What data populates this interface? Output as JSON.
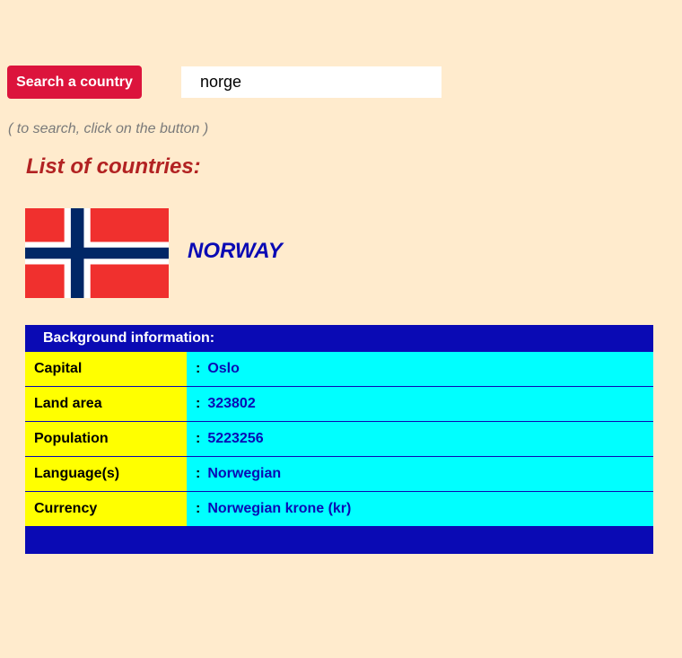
{
  "search": {
    "button_label": "Search a country",
    "input_value": "norge",
    "hint": "( to search, click on the button )"
  },
  "list_title": "List of countries:",
  "country": {
    "name": "NORWAY",
    "flag_icon": "norway-flag",
    "flag_colors": {
      "red": "#f0302e",
      "white": "#ffffff",
      "blue": "#002766"
    }
  },
  "info": {
    "header": "Background information:",
    "separator": ":",
    "rows": [
      {
        "label": "Capital",
        "value": "Oslo"
      },
      {
        "label": "Land area",
        "value": "323802"
      },
      {
        "label": "Population",
        "value": "5223256"
      },
      {
        "label": "Language(s)",
        "value": "Norwegian"
      },
      {
        "label": "Currency",
        "value": "Norwegian krone (kr)"
      }
    ]
  },
  "colors": {
    "page_background": "#ffebcd",
    "button": "#dc143c",
    "title": "#b22222",
    "country_name": "#0a0ab4",
    "table_frame": "#0a0ab4",
    "label_cell": "#ffff00",
    "value_cell": "#00ffff"
  }
}
